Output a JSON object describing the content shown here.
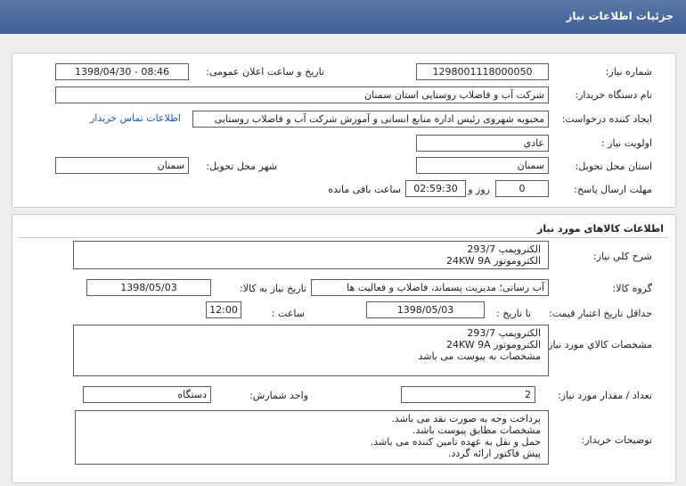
{
  "title": "جزئیات اطلاعات نیاز",
  "need": {
    "number_label": "شماره نیاز:",
    "number": "1298001118000050",
    "announce_label": "تاریخ و ساعت اعلان عمومی:",
    "announce": "1398/04/30 - 08:46",
    "buyer_label": "نام دستگاه خریدار:",
    "buyer": "شرکت آب و فاضلاب روستایی استان سمنان",
    "creator_label": "ایجاد کننده درخواست:",
    "creator": "محبوبه شهروی رئیس اداره منابع انسانی و آموزش شرکت آب و فاضلاب روستایی",
    "contact_link": "اطلاعات تماس خریدار",
    "priority_label": "اولویت نیاز :",
    "priority": "عادي",
    "province_label": "استان محل تحویل:",
    "province": "سمنان",
    "city_label": "شهر محل تحویل:",
    "city": "سمنان",
    "deadline_label": "مهلت ارسال پاسخ:",
    "days": "0",
    "day_word": "روز و",
    "time_left": "02:59:30",
    "time_left_word": "ساعت باقی مانده"
  },
  "goods": {
    "section_title": "اطلاعات کالاهای مورد نیاز",
    "desc_label": "شرح کلي نياز:",
    "desc_lines": [
      "الکتروپمپ 293/7",
      "الکتروموتور 24KW 9A"
    ],
    "group_label": "گروه کالا:",
    "group": "آب رسانی؛ مدیریت پسماند، فاضلاب و فعالیت ها",
    "need_date_label": "تاریخ نیاز به کالا:",
    "need_date": "1398/05/03",
    "validity_label": "حداقل تاریخ اعتبار قیمت:",
    "until_label": "تا تاریخ :",
    "validity_date": "1398/05/03",
    "hour_label": "ساعت :",
    "validity_time": "12:00",
    "spec_label": "مشخصات کالاي مورد نياز:",
    "spec_lines": [
      "الکتروپمپ 293/7",
      "الکتروموتور 24KW 9A",
      "مشخصات به پیوست می باشد"
    ],
    "qty_label": "تعداد / مقدار مورد نیاز:",
    "qty": "2",
    "unit_label": "واحد شمارش:",
    "unit": "دستگاه",
    "notes_label": "توضیحات خریدار:",
    "notes_lines": [
      "پرداخت وجه به صورت نقد می باشد.",
      "مشخصات مطابق پیوست باشد.",
      "حمل و نقل به عهده تامین کننده می باشد.",
      "پیش فاکتور ارائه گردد."
    ]
  }
}
